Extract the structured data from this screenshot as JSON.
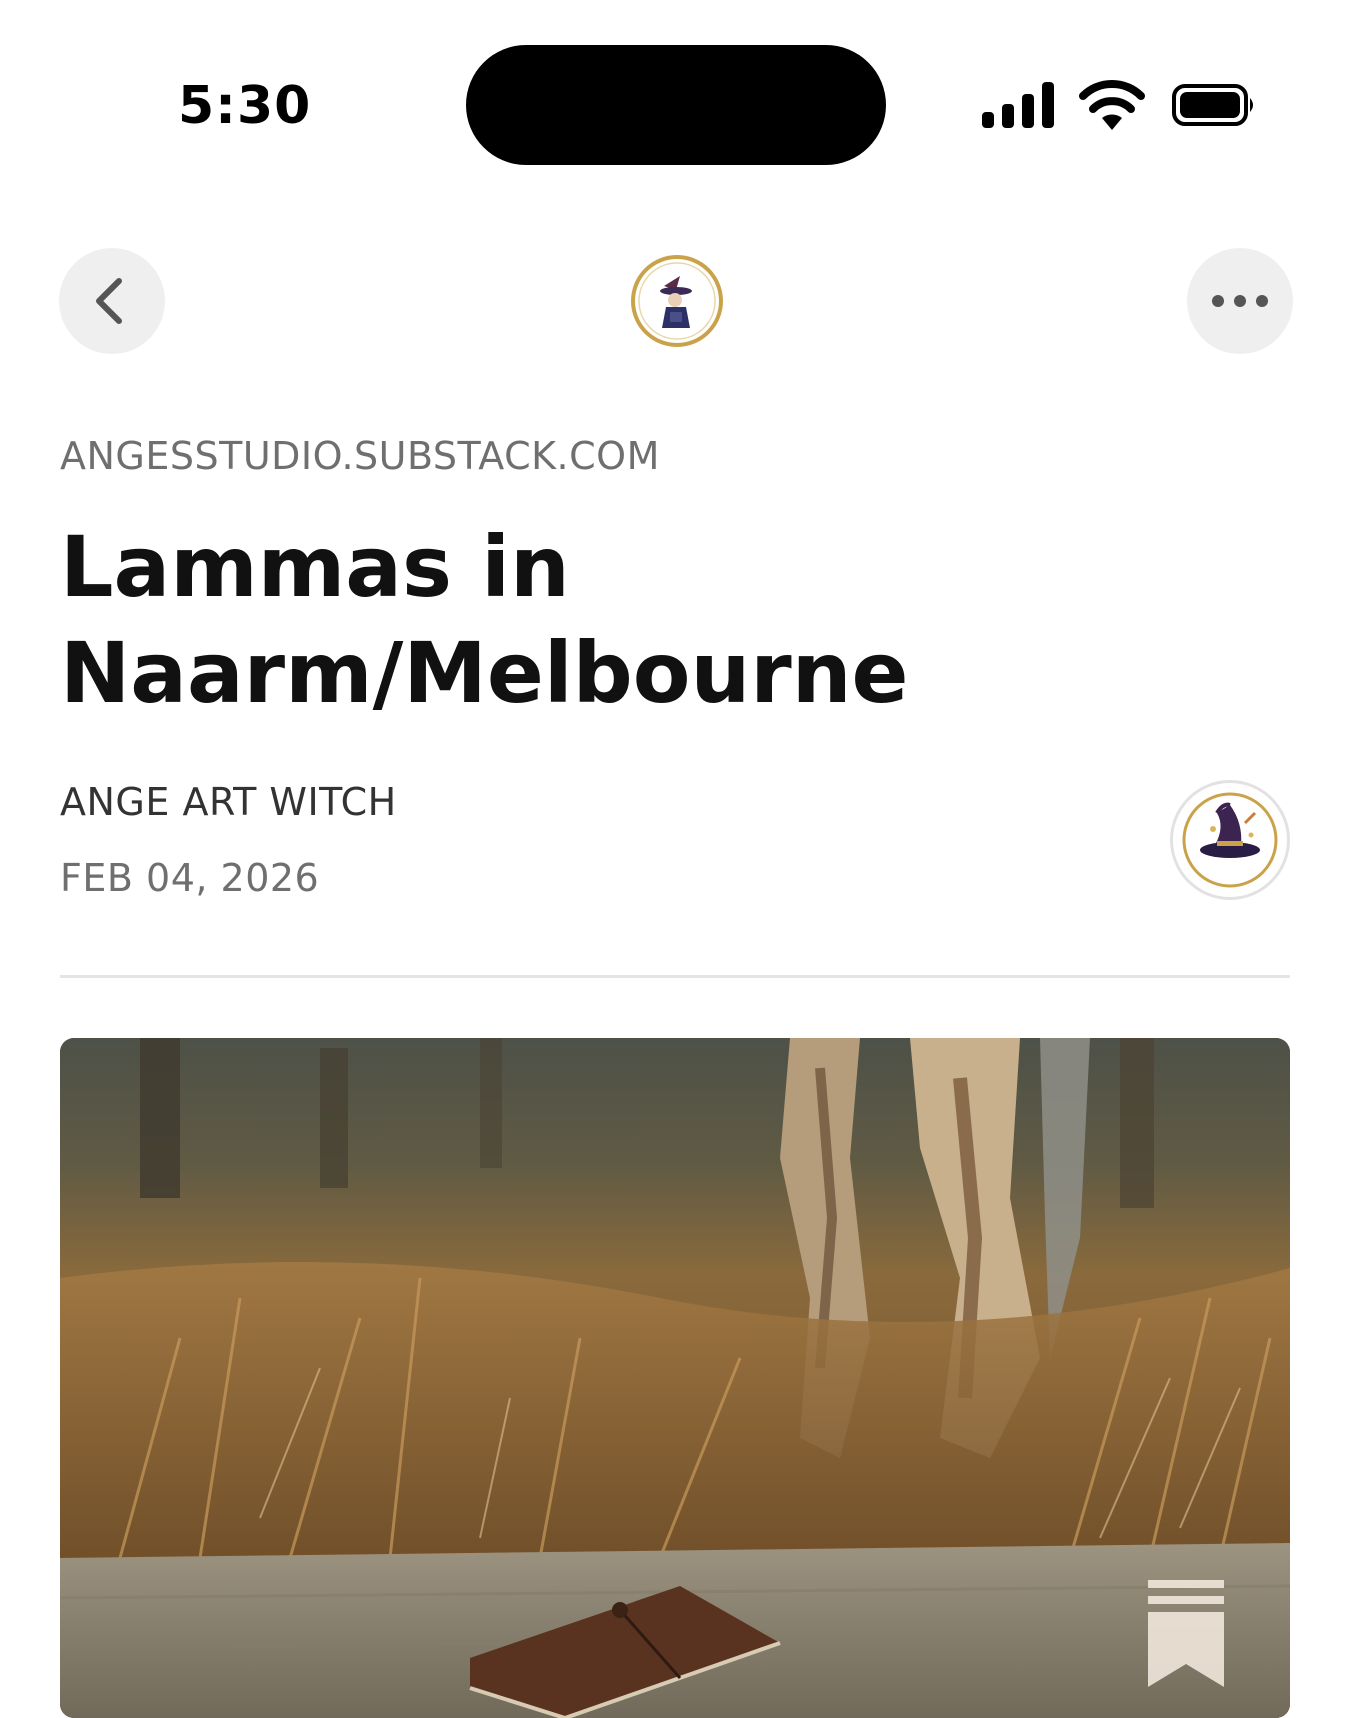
{
  "status_bar": {
    "time": "5:30",
    "icons": [
      "cellular-signal-icon",
      "wifi-icon",
      "battery-icon"
    ]
  },
  "nav": {
    "back_icon": "chevron-left-icon",
    "publication_logo": "witch-hat-logo",
    "more_icon": "ellipsis-icon"
  },
  "post": {
    "publication_domain": "ANGESSTUDIO.SUBSTACK.COM",
    "title": "Lammas in Naarm/Melbourne",
    "author": "ANGE ART WITCH",
    "date": "FEB 04, 2026"
  },
  "hero": {
    "image_icon": "bookmark-icon"
  },
  "colors": {
    "background": "#ffffff",
    "nav_button_bg": "#efefef",
    "muted_text": "#6f6f6f",
    "title_text": "#111111",
    "divider": "#e4e4e4",
    "logo_ring": "#c9a24a"
  }
}
